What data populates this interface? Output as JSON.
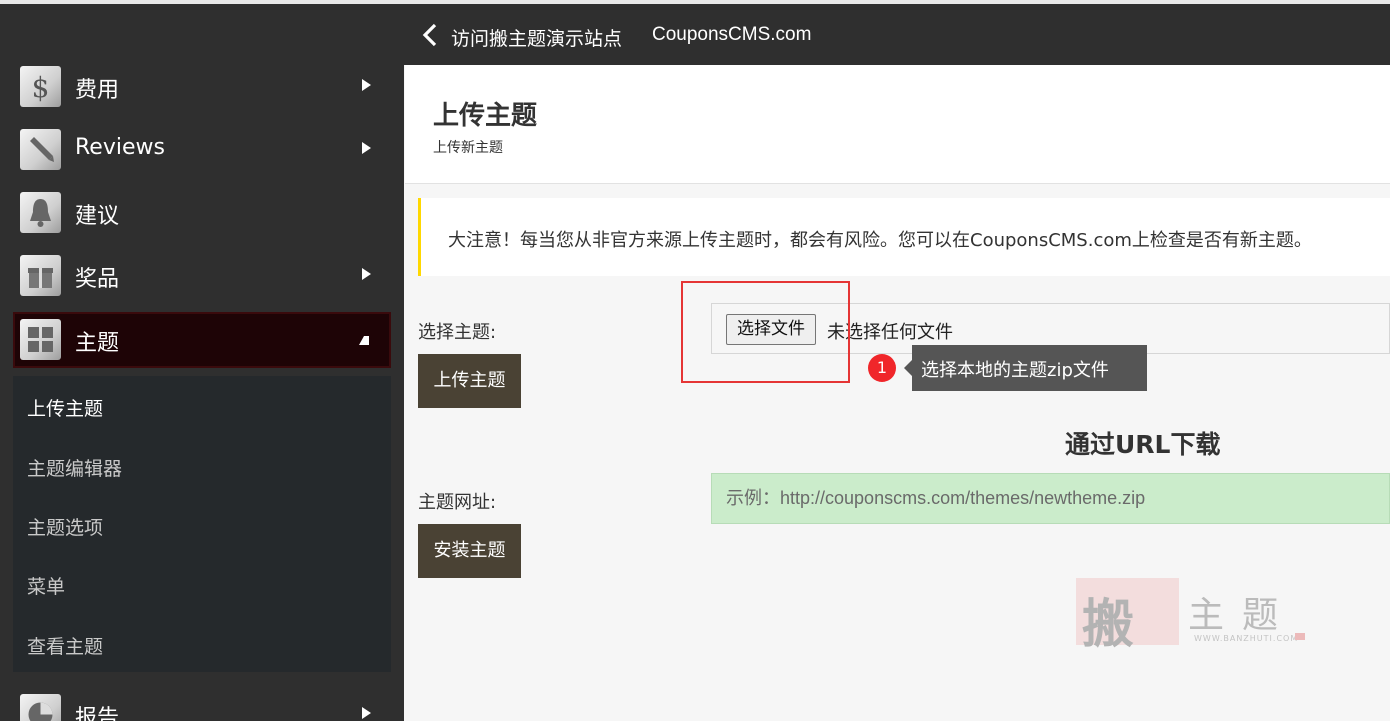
{
  "topbar": {
    "back_label": "访问搬主题演示站点",
    "brand": "CouponsCMS.com"
  },
  "sidebar": {
    "items": [
      {
        "label": "费用",
        "icon": "dollar-icon",
        "arrow": "right"
      },
      {
        "label": "Reviews",
        "icon": "pencil-icon",
        "arrow": "right"
      },
      {
        "label": "建议",
        "icon": "bell-icon",
        "arrow": "none"
      },
      {
        "label": "奖品",
        "icon": "gift-icon",
        "arrow": "right"
      },
      {
        "label": "主题",
        "icon": "grid-icon",
        "arrow": "down",
        "active": true
      },
      {
        "label": "报告",
        "icon": "pie-chart-icon",
        "arrow": "right"
      }
    ],
    "submenu": [
      {
        "label": "上传主题",
        "current": true
      },
      {
        "label": "主题编辑器"
      },
      {
        "label": "主题选项"
      },
      {
        "label": "菜单"
      },
      {
        "label": "查看主题"
      }
    ]
  },
  "page": {
    "title": "上传主题",
    "subtitle": "上传新主题"
  },
  "notice": "大注意！每当您从非官方来源上传主题时，都会有风险。您可以在CouponsCMS.com上检查是否有新主题。",
  "upload": {
    "label": "选择主题:",
    "file_button": "选择文件",
    "file_status": "未选择任何文件",
    "submit": "上传主题"
  },
  "annotation": {
    "badge": "1",
    "tip": "选择本地的主题zip文件",
    "highlight_color": "#e53535"
  },
  "url_section": {
    "heading": "通过URL下载",
    "label": "主题网址:",
    "placeholder": "示例：http://couponscms.com/themes/newtheme.zip",
    "submit": "安装主题"
  },
  "watermark": {
    "seal": "搬",
    "text": "主题",
    "url": "WWW.BANZHUTI.COM"
  },
  "colors": {
    "sidebar_bg": "#2f2f2f",
    "active_item_bg": "#1e0406",
    "submenu_bg": "#25292c",
    "button_bg": "#4a4234",
    "notice_border": "#ffd800",
    "url_input_bg": "#cbeccb"
  }
}
